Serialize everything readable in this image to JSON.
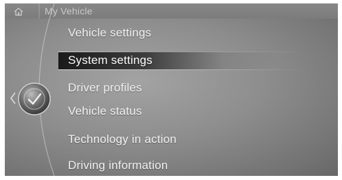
{
  "header": {
    "title": "My Vehicle",
    "icon": "home-icon"
  },
  "menu": {
    "items": [
      {
        "label": "Vehicle settings",
        "selected": false
      },
      {
        "label": "System settings",
        "selected": true
      },
      {
        "label": "Driver profiles",
        "selected": false
      },
      {
        "label": "Vehicle status",
        "selected": false
      },
      {
        "label": "Technology in action",
        "selected": false
      },
      {
        "label": "Driving information",
        "selected": false
      }
    ]
  },
  "controller": {
    "icon": "controller-knob-icon",
    "left_indicator": "chevron-left-icon"
  },
  "colors": {
    "background": "#8d8d8d",
    "text": "#f2f2f2",
    "highlight": "#1e1e1e",
    "title": "#c9c9c9"
  }
}
